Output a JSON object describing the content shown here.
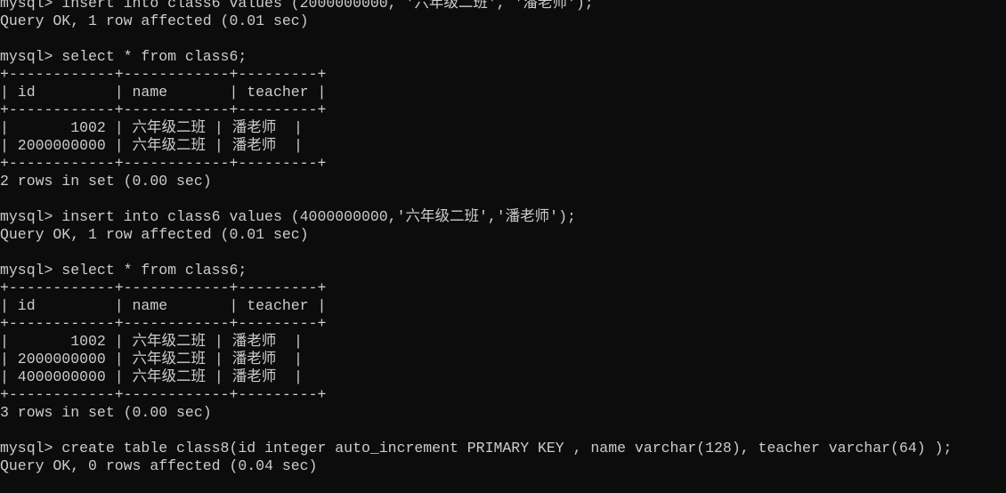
{
  "terminal": {
    "background": "#0c0c0c",
    "foreground": "#cccccc",
    "lines": [
      "mysql> insert into class6 values (2000000000, '六年级二班', '潘老师');",
      "Query OK, 1 row affected (0.01 sec)",
      "",
      "mysql> select * from class6;",
      "+------------+------------+---------+",
      "| id         | name       | teacher |",
      "+------------+------------+---------+",
      "|       1002 | 六年级二班 | 潘老师  |",
      "| 2000000000 | 六年级二班 | 潘老师  |",
      "+------------+------------+---------+",
      "2 rows in set (0.00 sec)",
      "",
      "mysql> insert into class6 values (4000000000,'六年级二班','潘老师');",
      "Query OK, 1 row affected (0.01 sec)",
      "",
      "mysql> select * from class6;",
      "+------------+------------+---------+",
      "| id         | name       | teacher |",
      "+------------+------------+---------+",
      "|       1002 | 六年级二班 | 潘老师  |",
      "| 2000000000 | 六年级二班 | 潘老师  |",
      "| 4000000000 | 六年级二班 | 潘老师  |",
      "+------------+------------+---------+",
      "3 rows in set (0.00 sec)",
      "",
      "mysql> create table class8(id integer auto_increment PRIMARY KEY , name varchar(128), teacher varchar(64) );",
      "Query OK, 0 rows affected (0.04 sec)",
      ""
    ]
  }
}
